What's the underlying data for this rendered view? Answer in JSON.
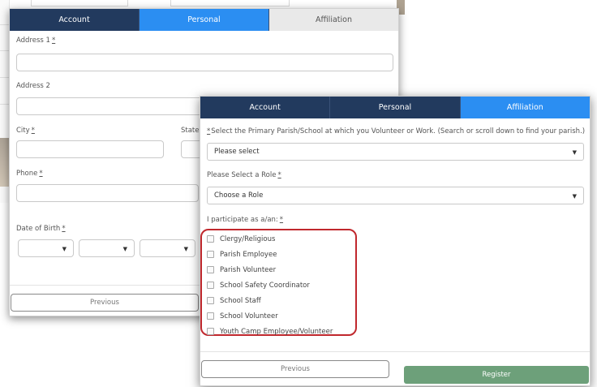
{
  "back_form": {
    "tabs": [
      {
        "label": "Account",
        "active": false
      },
      {
        "label": "Personal",
        "active": true
      },
      {
        "label": "Affiliation",
        "active": false
      }
    ],
    "address1_label": "Address 1",
    "address2_label": "Address 2",
    "city_label": "City",
    "state_label": "State",
    "phone_label": "Phone",
    "dob_label": "Date of Birth",
    "required_mark": "*",
    "previous_label": "Previous"
  },
  "front_form": {
    "tabs": [
      {
        "label": "Account",
        "active": false
      },
      {
        "label": "Personal",
        "active": false
      },
      {
        "label": "Affiliation",
        "active": true
      }
    ],
    "parish_label": "Select the Primary Parish/School at which you Volunteer or Work. (Search or scroll down to find your parish.)",
    "parish_value": "Please select",
    "role_label": "Please Select a Role",
    "role_value": "Choose a Role",
    "participate_label": "I participate as a/an:",
    "required_mark": "*",
    "options": [
      {
        "label": "Clergy/Religious"
      },
      {
        "label": "Parish Employee"
      },
      {
        "label": "Parish Volunteer"
      },
      {
        "label": "School Safety Coordinator"
      },
      {
        "label": "School Staff"
      },
      {
        "label": "School Volunteer"
      },
      {
        "label": "Youth Camp Employee/Volunteer"
      }
    ],
    "previous_label": "Previous",
    "register_label": "Register"
  },
  "colors": {
    "tab_dark": "#223a5e",
    "tab_active": "#2b8ef2",
    "register_green": "#6da07a",
    "highlight_red": "#c0282d"
  }
}
